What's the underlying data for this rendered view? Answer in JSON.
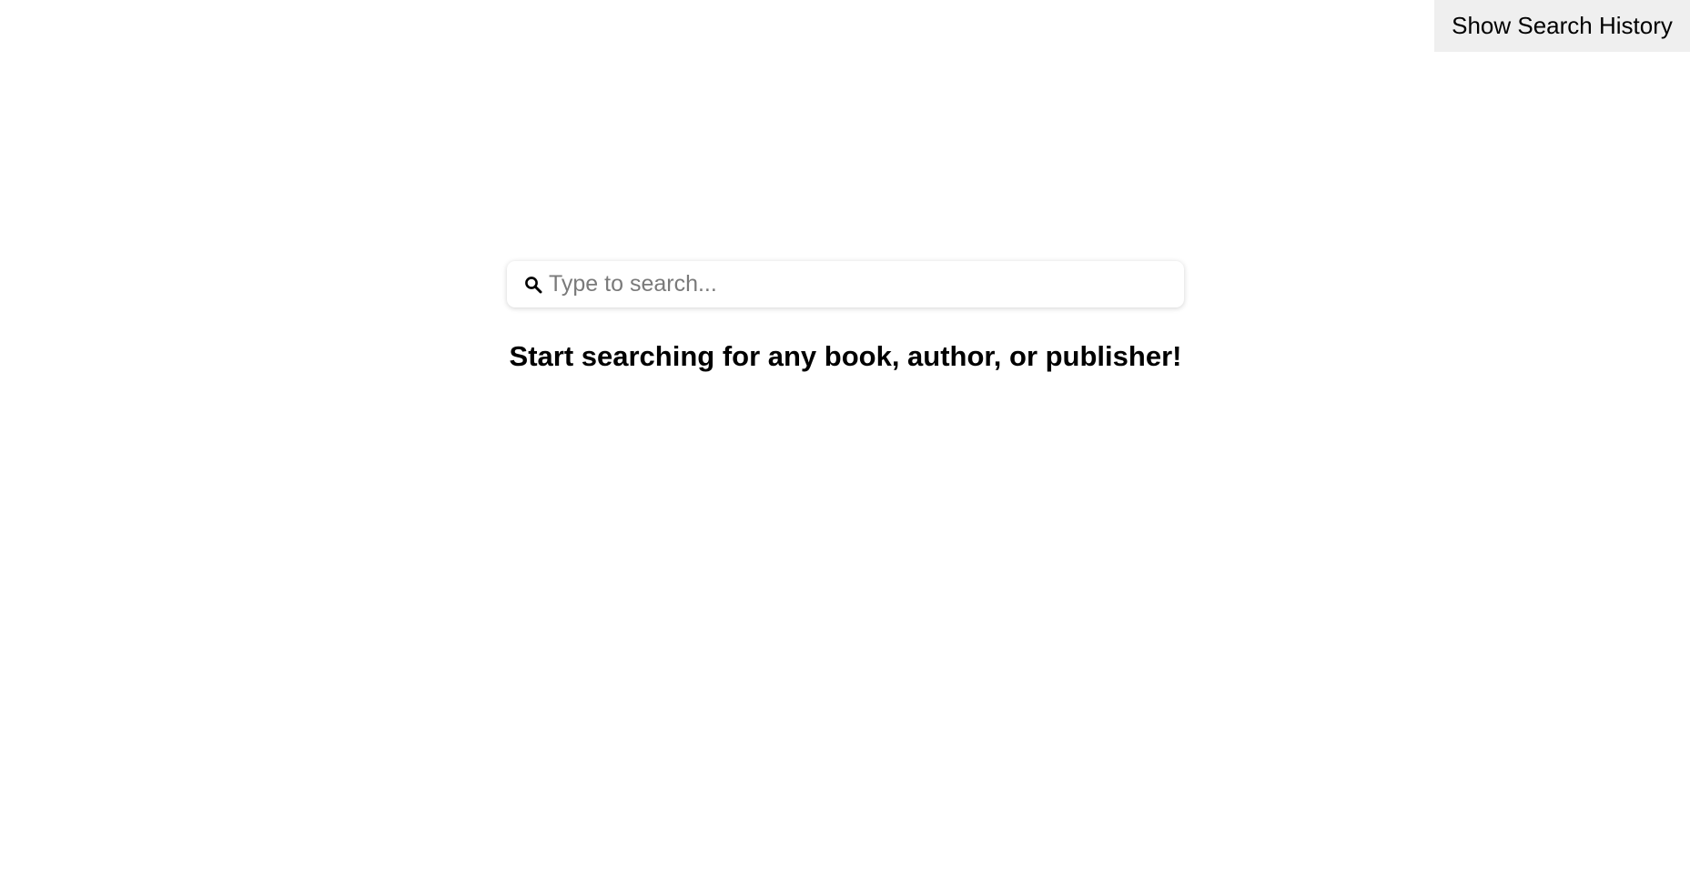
{
  "header": {
    "history_button_label": "Show Search History"
  },
  "search": {
    "placeholder": "Type to search...",
    "value": "",
    "icon": "search-icon"
  },
  "main": {
    "prompt": "Start searching for any book, author, or publisher!"
  },
  "colors": {
    "history_button_bg": "#efefef",
    "text": "#000000",
    "placeholder": "#7a7a7a",
    "background": "#ffffff"
  }
}
